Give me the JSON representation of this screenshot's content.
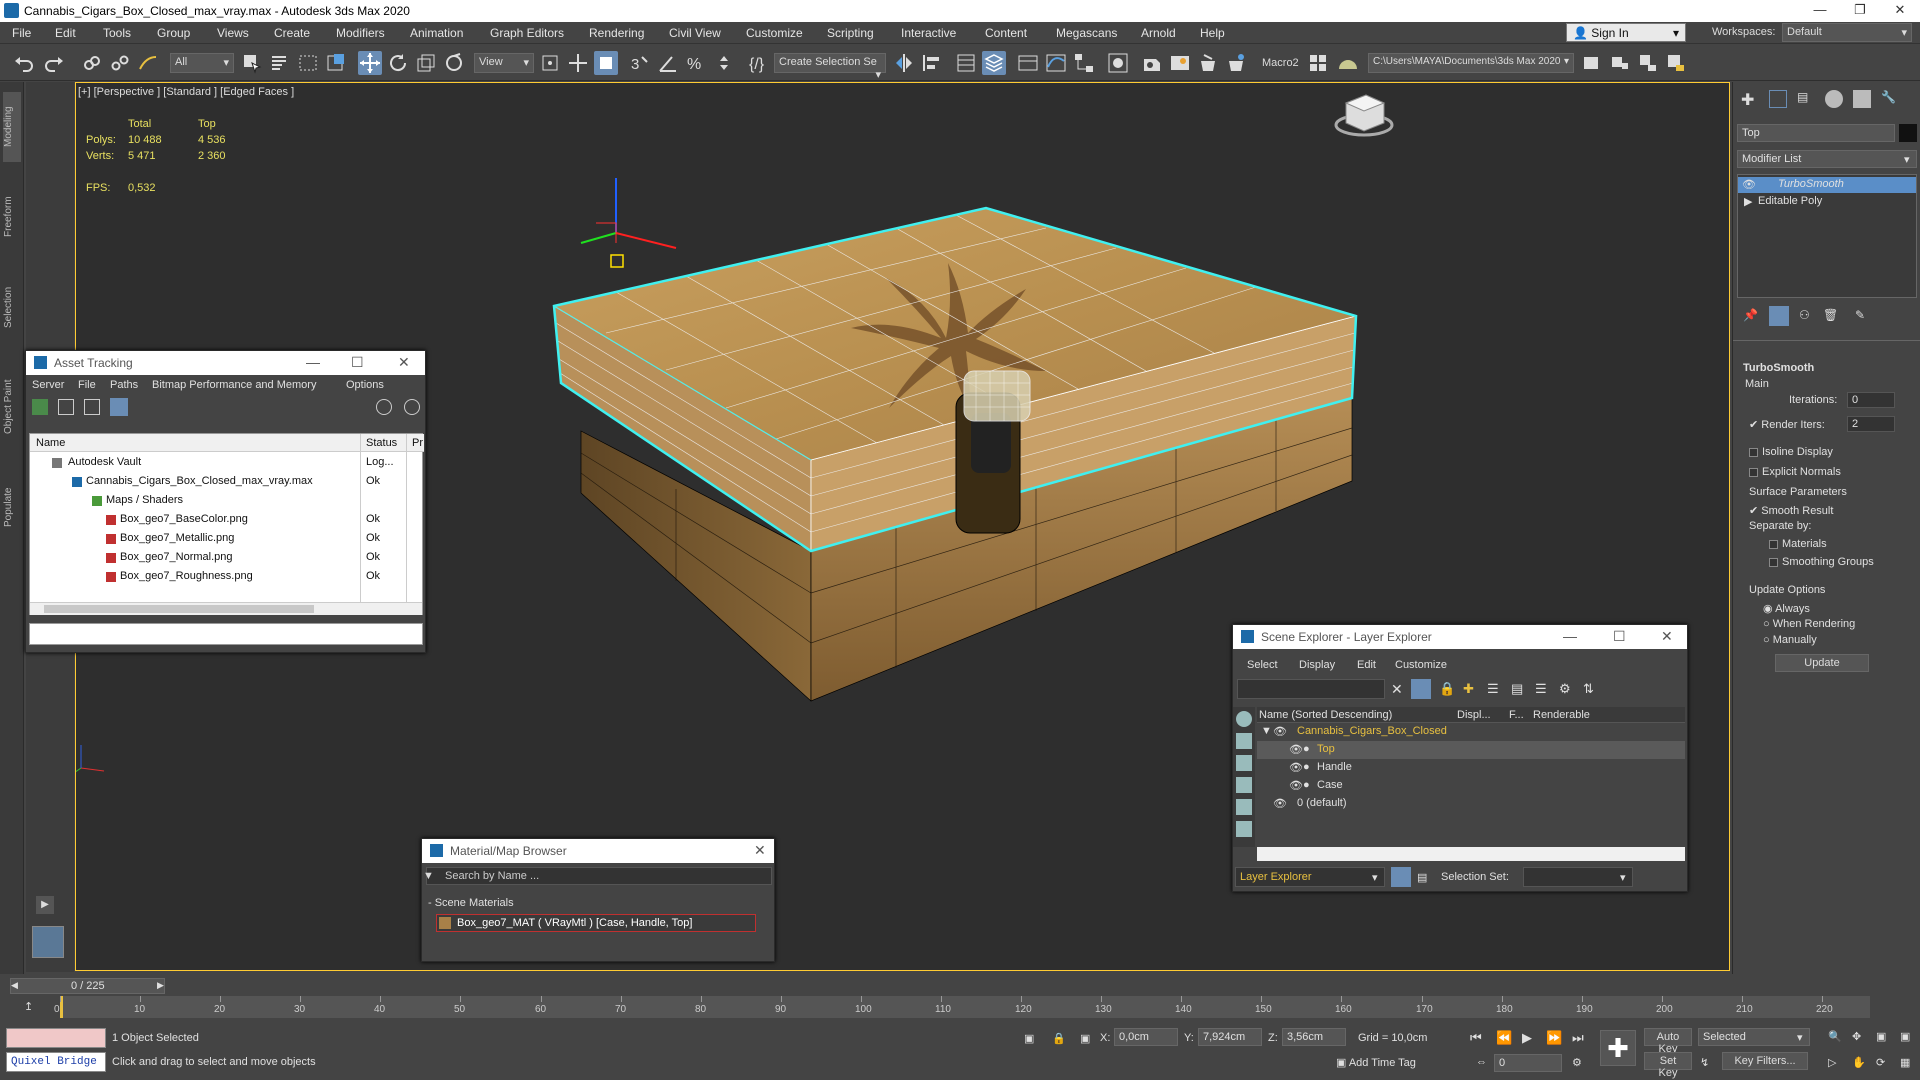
{
  "window": {
    "title": "Cannabis_Cigars_Box_Closed_max_vray.max - Autodesk 3ds Max 2020"
  },
  "menu": [
    "File",
    "Edit",
    "Tools",
    "Group",
    "Views",
    "Create",
    "Modifiers",
    "Animation",
    "Graph Editors",
    "Rendering",
    "Civil View",
    "Customize",
    "Scripting",
    "Interactive",
    "Content",
    "Megascans",
    "Arnold",
    "Help"
  ],
  "account": {
    "sign_in": "Sign In",
    "workspaces_label": "Workspaces:",
    "workspace": "Default"
  },
  "toolbar": {
    "filter": "All",
    "view": "View",
    "selection_set": "Create Selection Se",
    "macro": "Macro2",
    "project_path": "C:\\Users\\MAYA\\Documents\\3ds Max 2020"
  },
  "side_tabs": [
    "Modeling",
    "Freeform",
    "Selection",
    "Object Paint",
    "Populate"
  ],
  "viewport": {
    "label": "[+] [Perspective ] [Standard ] [Edged Faces ]",
    "stats": {
      "total_label": "Total",
      "top_label": "Top",
      "polys_label": "Polys:",
      "polys_total": "10 488",
      "polys_top": "4 536",
      "verts_label": "Verts:",
      "verts_total": "5 471",
      "verts_top": "2 360",
      "fps_label": "FPS:",
      "fps": "0,532"
    }
  },
  "asset_tracking": {
    "title": "Asset Tracking",
    "menu": [
      "Server",
      "File",
      "Paths",
      "Bitmap Performance and Memory",
      "Options"
    ],
    "columns": [
      "Name",
      "Status",
      "Pr"
    ],
    "rows": [
      {
        "name": "Autodesk Vault",
        "status": "Log..."
      },
      {
        "name": "Cannabis_Cigars_Box_Closed_max_vray.max",
        "status": "Ok"
      },
      {
        "name": "Maps / Shaders",
        "status": ""
      },
      {
        "name": "Box_geo7_BaseColor.png",
        "status": "Ok"
      },
      {
        "name": "Box_geo7_Metallic.png",
        "status": "Ok"
      },
      {
        "name": "Box_geo7_Normal.png",
        "status": "Ok"
      },
      {
        "name": "Box_geo7_Roughness.png",
        "status": "Ok"
      }
    ]
  },
  "material_browser": {
    "title": "Material/Map Browser",
    "search_placeholder": "Search by Name ...",
    "group": "- Scene Materials",
    "item": "Box_geo7_MAT ( VRayMtl ) [Case, Handle, Top]"
  },
  "scene_explorer": {
    "title": "Scene Explorer - Layer Explorer",
    "menu": [
      "Select",
      "Display",
      "Edit",
      "Customize"
    ],
    "columns": [
      "Name (Sorted Descending)",
      "Displ...",
      "F...",
      "Renderable"
    ],
    "rows": [
      "Cannabis_Cigars_Box_Closed",
      "Top",
      "Handle",
      "Case",
      "0 (default)"
    ],
    "footer_mode": "Layer Explorer",
    "selection_set_label": "Selection Set:"
  },
  "command_panel": {
    "object_name": "Top",
    "modifier_list": "Modifier List",
    "stack": [
      "TurboSmooth",
      "Editable Poly"
    ],
    "rollout": "TurboSmooth",
    "main_label": "Main",
    "iterations_label": "Iterations:",
    "iterations": "0",
    "render_iters_label": "Render Iters:",
    "render_iters": "2",
    "isoline": "Isoline Display",
    "explicit_normals": "Explicit Normals",
    "surface_params": "Surface Parameters",
    "smooth_result": "Smooth Result",
    "separate_by": "Separate by:",
    "materials": "Materials",
    "smoothing_groups": "Smoothing Groups",
    "update_options": "Update Options",
    "always": "Always",
    "when_rendering": "When Rendering",
    "manually": "Manually",
    "update_btn": "Update"
  },
  "timeline": {
    "frame": "0 / 225",
    "ticks": [
      "0",
      "10",
      "20",
      "30",
      "40",
      "50",
      "60",
      "70",
      "80",
      "90",
      "100",
      "110",
      "120",
      "130",
      "140",
      "150",
      "160",
      "170",
      "180",
      "190",
      "200",
      "210",
      "220"
    ]
  },
  "status": {
    "quixel": "Quixel Bridge",
    "selected": "1 Object Selected",
    "hint": "Click and drag to select and move objects",
    "x_label": "X:",
    "x": "0,0cm",
    "y_label": "Y:",
    "y": "7,924cm",
    "z_label": "Z:",
    "z": "3,56cm",
    "grid": "Grid = 10,0cm",
    "add_time_tag": "Add Time Tag",
    "autokey": "Auto Key",
    "setkey": "Set Key",
    "selected_dd": "Selected",
    "key_filters": "Key Filters...",
    "frame_field": "0"
  }
}
